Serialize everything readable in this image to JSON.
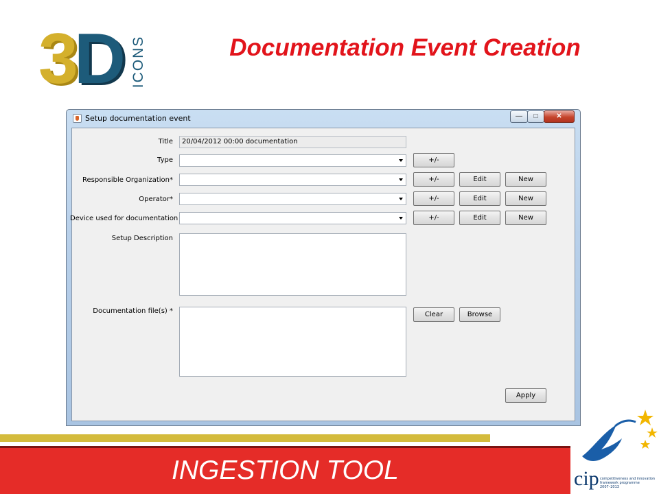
{
  "slide": {
    "title": "Documentation Event Creation",
    "logo_text": "3D",
    "logo_subtext": "ICONS",
    "banner_text": "INGESTION TOOL",
    "sponsor_logo": {
      "word": "cip",
      "tagline_1": "competitiveness and innovation",
      "tagline_2": "framework programme",
      "years": "2007–2013"
    },
    "colors": {
      "title_red": "#e2141b",
      "banner_red": "#e52c28",
      "gold": "#d4bb3c",
      "logo_gold": "#d4b02c",
      "logo_blue": "#1d5b7a"
    }
  },
  "window": {
    "title": "Setup documentation event",
    "controls": {
      "minimize": "minimize-icon",
      "maximize": "maximize-icon",
      "close": "close-icon"
    },
    "form": {
      "title_label": "Title",
      "title_value": "20/04/2012 00:00 documentation",
      "type_label": "Type",
      "type_value": "",
      "responsible_org_label": "Responsible Organization*",
      "responsible_org_value": "",
      "operator_label": "Operator*",
      "operator_value": "",
      "device_label": "Device used for documentation",
      "device_value": "",
      "setup_description_label": "Setup Description",
      "setup_description_value": "",
      "documentation_files_label": "Documentation file(s) *",
      "documentation_files_value": ""
    },
    "buttons": {
      "plus_minus": "+/-",
      "edit": "Edit",
      "new": "New",
      "clear": "Clear",
      "browse": "Browse",
      "apply": "Apply"
    }
  }
}
